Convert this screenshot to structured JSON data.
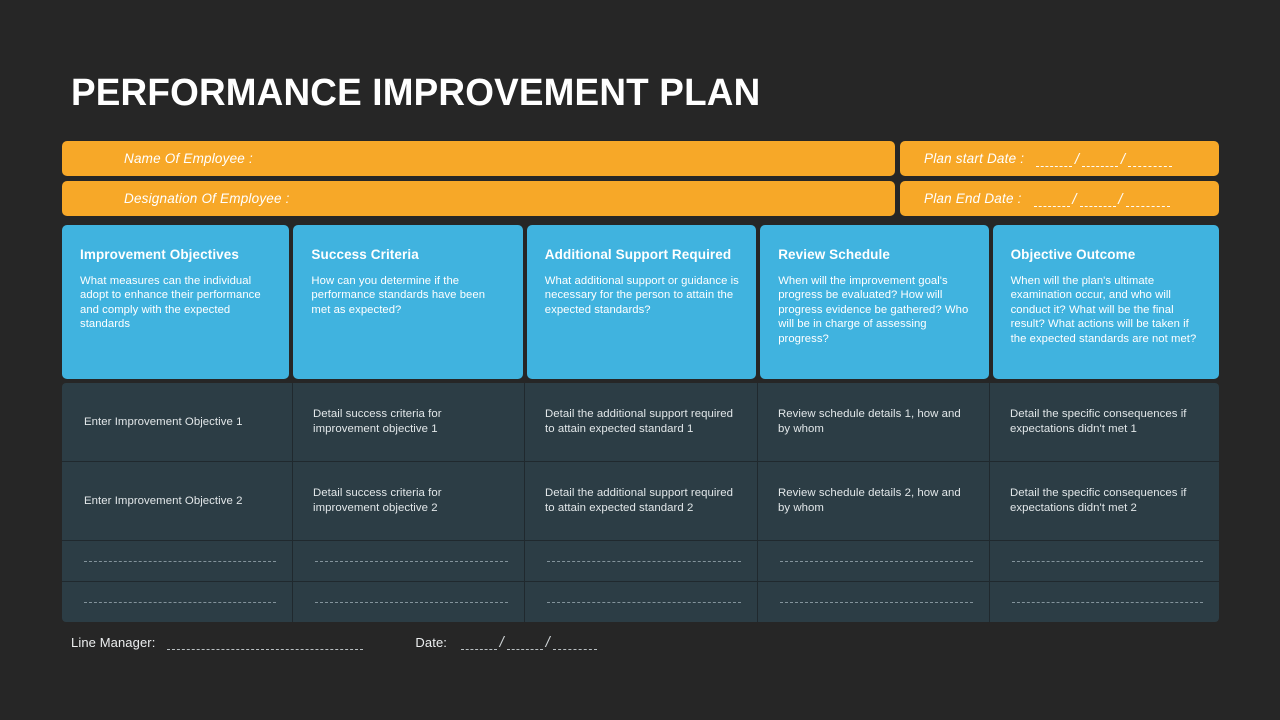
{
  "page_title": "PERFORMANCE IMPROVEMENT PLAN",
  "colors": {
    "background": "#262626",
    "accent_orange": "#F7A828",
    "accent_blue": "#40B3DF",
    "cell_bg": "#2C3D45",
    "text_light": "#FFFFFF"
  },
  "info_bars": {
    "name_label": "Name Of Employee :",
    "designation_label": "Designation Of Employee :",
    "plan_start_label": "Plan start Date :",
    "plan_end_label": "Plan End Date :",
    "date_separator": "/"
  },
  "table": {
    "headers": [
      {
        "title": "Improvement Objectives",
        "description": "What measures can the individual adopt to enhance their performance and comply with the expected standards"
      },
      {
        "title": "Success Criteria",
        "description": "How can you determine if the performance standards have been met as expected?"
      },
      {
        "title": "Additional Support Required",
        "description": "What additional support or guidance is necessary for the person to attain the expected standards?"
      },
      {
        "title": "Review Schedule",
        "description": "When will the improvement goal's progress be evaluated? How will progress evidence be gathered? Who will be in charge of assessing progress?"
      },
      {
        "title": "Objective Outcome",
        "description": "When will the plan's ultimate examination occur, and who will conduct it? What will be the final result? What actions will be taken if the expected standards are not met?"
      }
    ],
    "rows": [
      [
        "Enter Improvement  Objective 1",
        "Detail success criteria for improvement objective 1",
        "Detail the additional support required to attain expected standard 1",
        "Review schedule details 1, how and by whom",
        "Detail the specific consequences if expectations didn't met 1"
      ],
      [
        "Enter Improvement  Objective 2",
        "Detail success criteria for improvement objective 2",
        "Detail the additional support required to attain expected standard 2",
        "Review schedule details 2, how and by whom",
        "Detail the specific consequences if expectations didn't met 2"
      ],
      [
        "",
        "",
        "",
        "",
        ""
      ],
      [
        "",
        "",
        "",
        "",
        ""
      ]
    ]
  },
  "footer": {
    "line_manager_label": "Line Manager:",
    "date_label": "Date:",
    "date_separator": "/"
  }
}
